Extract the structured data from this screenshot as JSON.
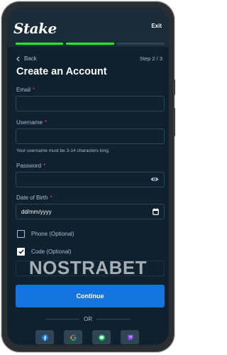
{
  "header": {
    "logo_text": "Stake",
    "exit_label": "Exit"
  },
  "progress": {
    "total_steps": 3,
    "completed_steps": 2
  },
  "nav": {
    "back_label": "Back",
    "step_label": "Step 2 / 3"
  },
  "page": {
    "title": "Create an Account"
  },
  "form": {
    "email": {
      "label": "Email",
      "required_mark": "*",
      "value": ""
    },
    "username": {
      "label": "Username",
      "required_mark": "*",
      "value": "",
      "hint": "Your username must be 3-14 characters long."
    },
    "password": {
      "label": "Password",
      "required_mark": "*",
      "value": ""
    },
    "dob": {
      "label": "Date of Birth",
      "required_mark": "*",
      "placeholder": "dd/mm/yyyy"
    },
    "phone": {
      "label": "Phone (Optional)",
      "checked": false
    },
    "code": {
      "label": "Code (Optional)",
      "checked": true
    }
  },
  "watermark": "NOSTRABET",
  "actions": {
    "continue_label": "Continue",
    "or_label": "OR"
  },
  "social_logins": [
    {
      "icon": "facebook-icon",
      "color": "#1877f2"
    },
    {
      "icon": "google-icon",
      "color": "#ea4335"
    },
    {
      "icon": "line-icon",
      "color": "#06c755"
    },
    {
      "icon": "twitch-icon",
      "color": "#9146ff"
    }
  ],
  "colors": {
    "background": "#0f212e",
    "topbar": "#1a2c38",
    "progress_active": "#1fff20",
    "button_primary": "#1475e1",
    "field_border": "#2f4553",
    "muted_text": "#b1bad3",
    "required": "#ed4163"
  }
}
